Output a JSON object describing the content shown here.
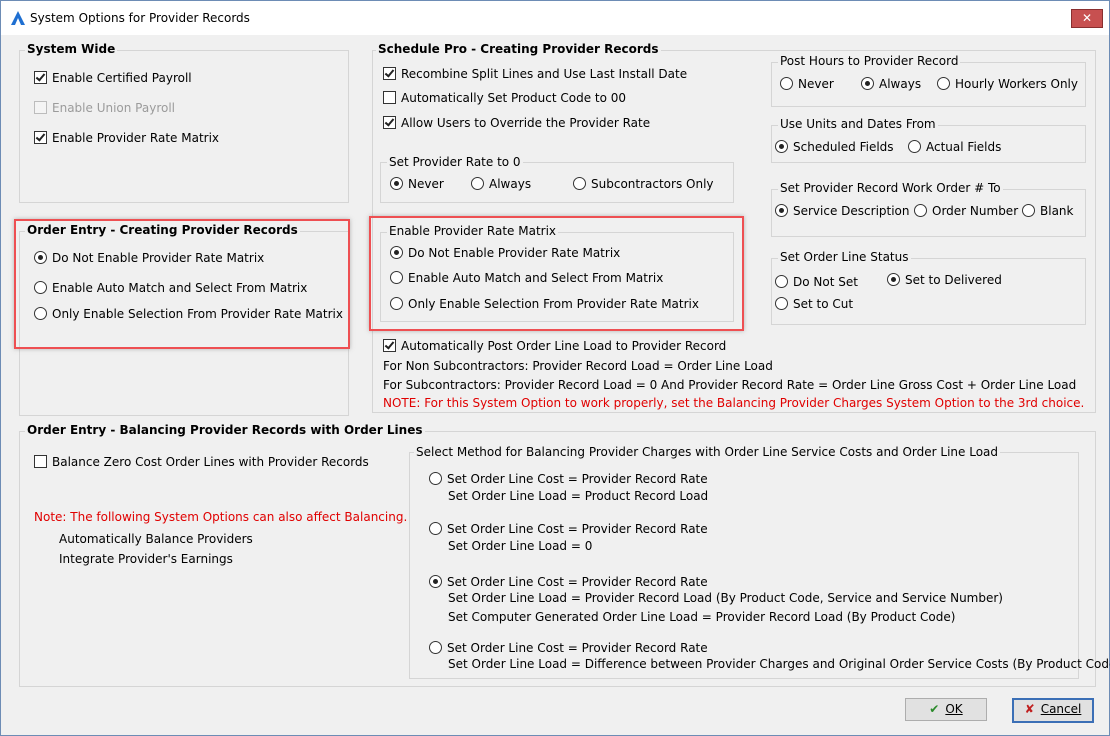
{
  "window": {
    "title": "System Options for Provider Records"
  },
  "system_wide": {
    "title": "System Wide",
    "items": [
      {
        "label": "Enable Certified Payroll",
        "checked": true,
        "disabled": false
      },
      {
        "label": "Enable Union Payroll",
        "checked": false,
        "disabled": true
      },
      {
        "label": "Enable Provider Rate Matrix",
        "checked": true,
        "disabled": false
      }
    ]
  },
  "order_entry_creating": {
    "title": "Order Entry - Creating Provider Records",
    "options": [
      "Do Not Enable Provider Rate Matrix",
      "Enable Auto Match and Select From Matrix",
      "Only Enable Selection From Provider Rate Matrix"
    ],
    "selected": 0
  },
  "schedule_pro": {
    "title": "Schedule Pro - Creating Provider Records",
    "checkboxes": [
      {
        "label": "Recombine Split Lines and Use Last Install Date",
        "checked": true
      },
      {
        "label": "Automatically Set Product Code to 00",
        "checked": false
      },
      {
        "label": "Allow Users to Override the Provider Rate",
        "checked": true
      }
    ],
    "set_rate": {
      "title": "Set Provider Rate to 0",
      "options": [
        "Never",
        "Always",
        "Subcontractors Only"
      ],
      "selected": 0
    },
    "matrix": {
      "title": "Enable Provider Rate Matrix",
      "options": [
        "Do Not Enable Provider Rate Matrix",
        "Enable Auto Match and Select From Matrix",
        "Only Enable Selection From Provider Rate Matrix"
      ],
      "selected": 0
    },
    "auto_post": {
      "label": "Automatically Post Order Line Load to Provider Record",
      "checked": true
    },
    "info_lines": [
      "For Non Subcontractors:  Provider Record Load = Order Line Load",
      "For Subcontractors:  Provider Record Load = 0  And  Provider Record Rate = Order Line Gross Cost + Order Line Load"
    ],
    "note": "NOTE:  For this System Option to work properly, set the Balancing Provider Charges System Option to the 3rd choice."
  },
  "post_hours": {
    "title": "Post Hours to Provider Record",
    "options": [
      "Never",
      "Always",
      "Hourly Workers Only"
    ],
    "selected": 1
  },
  "use_units": {
    "title": "Use Units and Dates From",
    "options": [
      "Scheduled Fields",
      "Actual Fields"
    ],
    "selected": 0
  },
  "work_order": {
    "title": "Set Provider Record Work Order # To",
    "options": [
      "Service Description",
      "Order Number",
      "Blank"
    ],
    "selected": 0
  },
  "order_line_status": {
    "title": "Set Order Line Status",
    "options": [
      "Do Not Set",
      "Set to Delivered",
      "Set to Cut"
    ],
    "selected": 1
  },
  "balancing": {
    "title": "Order Entry - Balancing Provider Records with Order Lines",
    "checkbox": {
      "label": "Balance Zero Cost Order Lines with Provider Records",
      "checked": false
    },
    "note": "Note:  The following System Options can also affect Balancing.",
    "related": [
      "Automatically Balance Providers",
      "Integrate Provider's Earnings"
    ],
    "method": {
      "title": "Select Method for Balancing Provider Charges with Order Line Service Costs and Order Line Load",
      "options": [
        {
          "line1": "Set Order Line Cost = Provider Record Rate",
          "extra": [
            "Set Order Line Load = Product Record Load"
          ]
        },
        {
          "line1": "Set Order Line Cost = Provider Record Rate",
          "extra": [
            "Set Order Line Load = 0"
          ]
        },
        {
          "line1": "Set Order Line Cost = Provider Record Rate",
          "extra": [
            "Set Order Line Load = Provider Record Load (By Product Code, Service and Service Number)",
            "Set Computer Generated Order Line Load = Provider Record Load (By Product Code)"
          ]
        },
        {
          "line1": "Set Order Line Cost = Provider Record Rate",
          "extra": [
            "Set Order Line Load = Difference between Provider Charges and Original Order Service Costs (By Product Code)"
          ]
        }
      ],
      "selected": 2
    }
  },
  "buttons": {
    "ok": "OK",
    "cancel": "Cancel"
  },
  "colors": {
    "highlight": "#ee4f52",
    "note": "#e00000",
    "frame": "#6d8cb5"
  },
  "icons": {
    "app": "app-logo-icon",
    "close": "close-icon",
    "ok": "checkmark-icon",
    "cancel": "x-icon"
  }
}
